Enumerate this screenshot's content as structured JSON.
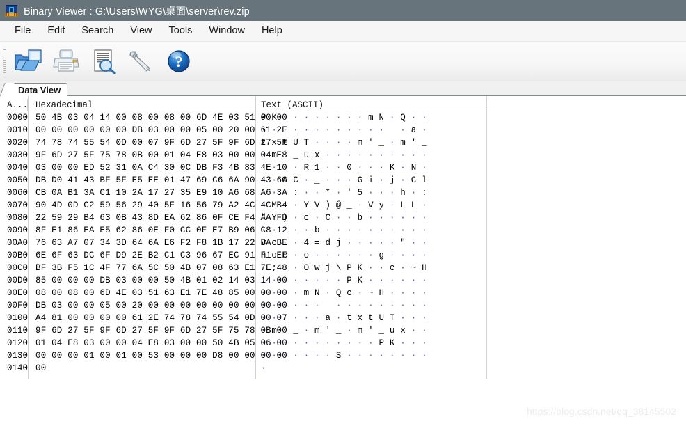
{
  "window": {
    "title": "Binary Viewer : G:\\Users\\WYG\\桌面\\server\\rev.zip",
    "icon": "chip-icon",
    "titlebar_color": "#67747b"
  },
  "menubar": {
    "items": [
      {
        "label": "File"
      },
      {
        "label": "Edit"
      },
      {
        "label": "Search"
      },
      {
        "label": "View"
      },
      {
        "label": "Tools"
      },
      {
        "label": "Window"
      },
      {
        "label": "Help"
      }
    ]
  },
  "toolbar": {
    "buttons": [
      {
        "name": "open-file-button",
        "icon": "open-folder-icon",
        "label": "Open"
      },
      {
        "name": "print-button",
        "icon": "printer-icon",
        "label": "Print"
      },
      {
        "name": "print-preview-button",
        "icon": "document-magnifier-icon",
        "label": "Print Preview"
      },
      {
        "name": "tools-button",
        "icon": "wrench-icon",
        "label": "Tools"
      },
      {
        "name": "help-button",
        "icon": "question-mark-icon",
        "label": "Help"
      }
    ]
  },
  "tabs": [
    {
      "label": "Data View",
      "active": true
    }
  ],
  "hexview": {
    "columns": {
      "address": "A...",
      "hex": "Hexadecimal",
      "text": "Text  (ASCII)"
    },
    "rows": [
      {
        "addr": "0000",
        "hex": "50 4B 03 04 14 00 08 00 08 00 6D 4E 03 51 00 00",
        "txt": "P K . . . . . . . . m N . Q . ."
      },
      {
        "addr": "0010",
        "hex": "00 00 00 00 00 00 DB 03 00 00 05 00 20 00 61 2E",
        "txt": ". . . . . . . . . . . .   . a ."
      },
      {
        "addr": "0020",
        "hex": "74 78 74 55 54 0D 00 07 9F 6D 27 5F 9F 6D 27 5F",
        "txt": "t x t U T . . . . m ' _ . m ' _"
      },
      {
        "addr": "0030",
        "hex": "9F 6D 27 5F 75 78 0B 00 01 04 E8 03 00 00 04 E8",
        "txt": ". m ' _ u x . . . . . . . . . ."
      },
      {
        "addr": "0040",
        "hex": "03 00 00 ED 52 31 0A C4 30 0C DB F3 4B 83 4E 10",
        "txt": ". . . . R 1 . . 0 . . . K . N ."
      },
      {
        "addr": "0050",
        "hex": "DB D0 41 43 BF 5F E5 EE 01 47 69 C6 6A 90 43 6C",
        "txt": ". . A C . _ . . . G i . j . C l"
      },
      {
        "addr": "0060",
        "hex": "CB 0A B1 3A C1 10 2A 17 27 35 E9 10 A6 68 A6 3A",
        "txt": ". . . : . . * . ' 5 . . . h . :"
      },
      {
        "addr": "0070",
        "hex": "90 4D 0D C2 59 56 29 40 5F 16 56 79 A2 4C 4C B4",
        "txt": ". M . . Y V ) @ _ . V y . L L ."
      },
      {
        "addr": "0080",
        "hex": "22 59 29 B4 63 0B 43 8D EA 62 86 0F CE F4 AA FD",
        "txt": "\" Y ) . c . C . . b . . . . . ."
      },
      {
        "addr": "0090",
        "hex": "8F E1 86 EA E5 62 86 0E F0 CC 0F E7 B9 06 C8 12",
        "txt": ". . . . . b . . . . . . . . . ."
      },
      {
        "addr": "00A0",
        "hex": "76 63 A7 07 34 3D 64 6A E6 F2 F8 1B 17 22 BA BE",
        "txt": "v c . . 4 = d j . . . . . \" . ."
      },
      {
        "addr": "00B0",
        "hex": "6E 6F 63 DC 6F D9 2E B2 C1 C3 96 67 EC 91 F1 EF",
        "txt": "n o c . o . . . . . . g . . . ."
      },
      {
        "addr": "00C0",
        "hex": "BF 3B F5 1C 4F 77 6A 5C 50 4B 07 08 63 E1 7E 48",
        "txt": ". ; . . O w j \\ P K . . c . ~ H"
      },
      {
        "addr": "00D0",
        "hex": "85 00 00 00 DB 03 00 00 50 4B 01 02 14 03 14 00",
        "txt": ". . . . . . . . P K . . . . . ."
      },
      {
        "addr": "00E0",
        "hex": "08 00 08 00 6D 4E 03 51 63 E1 7E 48 85 00 00 00",
        "txt": ". . . . m N . Q c . ~ H . . . ."
      },
      {
        "addr": "00F0",
        "hex": "DB 03 00 00 05 00 20 00 00 00 00 00 00 00 00 00",
        "txt": ". . . . . .   . . . . . . . . ."
      },
      {
        "addr": "0100",
        "hex": "A4 81 00 00 00 00 61 2E 74 78 74 55 54 0D 00 07",
        "txt": ". . . . . . a . t x t U T . . ."
      },
      {
        "addr": "0110",
        "hex": "9F 6D 27 5F 9F 6D 27 5F 9F 6D 27 5F 75 78 0B 00",
        "txt": ". m ' _ . m ' _ . m ' _ u x . ."
      },
      {
        "addr": "0120",
        "hex": "01 04 E8 03 00 00 04 E8 03 00 00 50 4B 05 06 00",
        "txt": ". . . . . . . . . . . P K . . ."
      },
      {
        "addr": "0130",
        "hex": "00 00 00 01 00 01 00 53 00 00 00 D8 00 00 00 00",
        "txt": ". . . . . . . S . . . . . . . ."
      },
      {
        "addr": "0140",
        "hex": "00",
        "txt": "."
      }
    ]
  },
  "watermark": {
    "text": "https://blog.csdn.net/qq_38145502"
  }
}
